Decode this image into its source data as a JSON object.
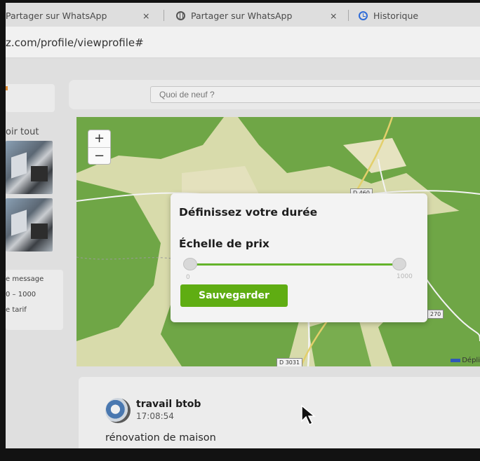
{
  "browser": {
    "tabs": [
      {
        "label": "Partager sur WhatsApp"
      },
      {
        "label": "Partager sur WhatsApp"
      },
      {
        "label": "Historique"
      }
    ],
    "tab_close_glyph": "×",
    "url": "z.com/profile/viewprofile#"
  },
  "page": {
    "search_placeholder": "Quoi de neuf ?",
    "sidebar": {
      "see_all": "oir tout",
      "info_lines": [
        "e message",
        "0   –   1000",
        "e tarif"
      ]
    }
  },
  "map": {
    "zoom_in": "+",
    "zoom_out": "−",
    "road_labels": [
      "D 460",
      "270",
      "D 3031"
    ],
    "attribution": "Dépli",
    "colors": {
      "forest": "#6fa646",
      "field": "#d6d9a8"
    }
  },
  "modal": {
    "title": "Définissez votre durée",
    "price_label": "Échelle de prix",
    "range_min": "0",
    "range_max": "1000",
    "range_value": [
      0,
      1000
    ],
    "save_label": "Sauvegarder",
    "accent": "#5fad12"
  },
  "post": {
    "author": "travail btob",
    "time": "17:08:54",
    "text": "rénovation de maison"
  }
}
